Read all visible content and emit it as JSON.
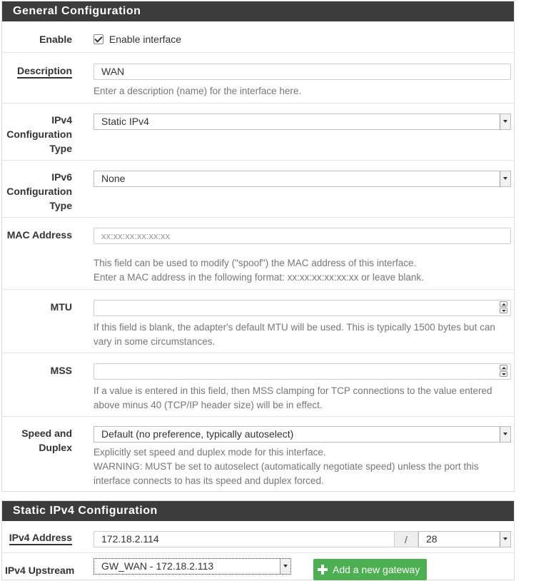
{
  "general": {
    "heading": "General Configuration",
    "enable": {
      "label": "Enable",
      "checkbox_label": "Enable interface",
      "checked": true
    },
    "description": {
      "label": "Description",
      "value": "WAN",
      "help": "Enter a description (name) for the interface here."
    },
    "ipv4_type": {
      "label_lines": [
        "IPv4",
        "Configuration",
        "Type"
      ],
      "value": "Static IPv4"
    },
    "ipv6_type": {
      "label_lines": [
        "IPv6",
        "Configuration",
        "Type"
      ],
      "value": "None"
    },
    "mac": {
      "label": "MAC Address",
      "placeholder": "xx:xx:xx:xx:xx:xx",
      "help_lines": [
        "This field can be used to modify (\"spoof\") the MAC address of this interface.",
        "Enter a MAC address in the following format: xx:xx:xx:xx:xx:xx or leave blank."
      ]
    },
    "mtu": {
      "label": "MTU",
      "value": "",
      "help_lines": [
        "If this field is blank, the adapter's default MTU will be used. This is typically 1500 bytes but can",
        "vary in some circumstances."
      ]
    },
    "mss": {
      "label": "MSS",
      "value": "",
      "help_lines": [
        "If a value is entered in this field, then MSS clamping for TCP connections to the value entered",
        "above minus 40 (TCP/IP header size) will be in effect."
      ]
    },
    "speed": {
      "label_lines": [
        "Speed and",
        "Duplex"
      ],
      "value": "Default (no preference, typically autoselect)",
      "help_lines": [
        "Explicitly set speed and duplex mode for this interface.",
        "WARNING: MUST be set to autoselect (automatically negotiate speed) unless the port this",
        "interface connects to has its speed and duplex forced."
      ]
    }
  },
  "static_ipv4": {
    "heading": "Static IPv4 Configuration",
    "address": {
      "label": "IPv4 Address",
      "value": "172.18.2.114",
      "separator": "/",
      "cidr": "28"
    },
    "upstream": {
      "label": "IPv4 Upstream",
      "value": "GW_WAN - 172.18.2.113",
      "add_button": "Add a new gateway"
    }
  },
  "colors": {
    "heading_bg": "#3c3c3c",
    "success": "#4caf50"
  }
}
